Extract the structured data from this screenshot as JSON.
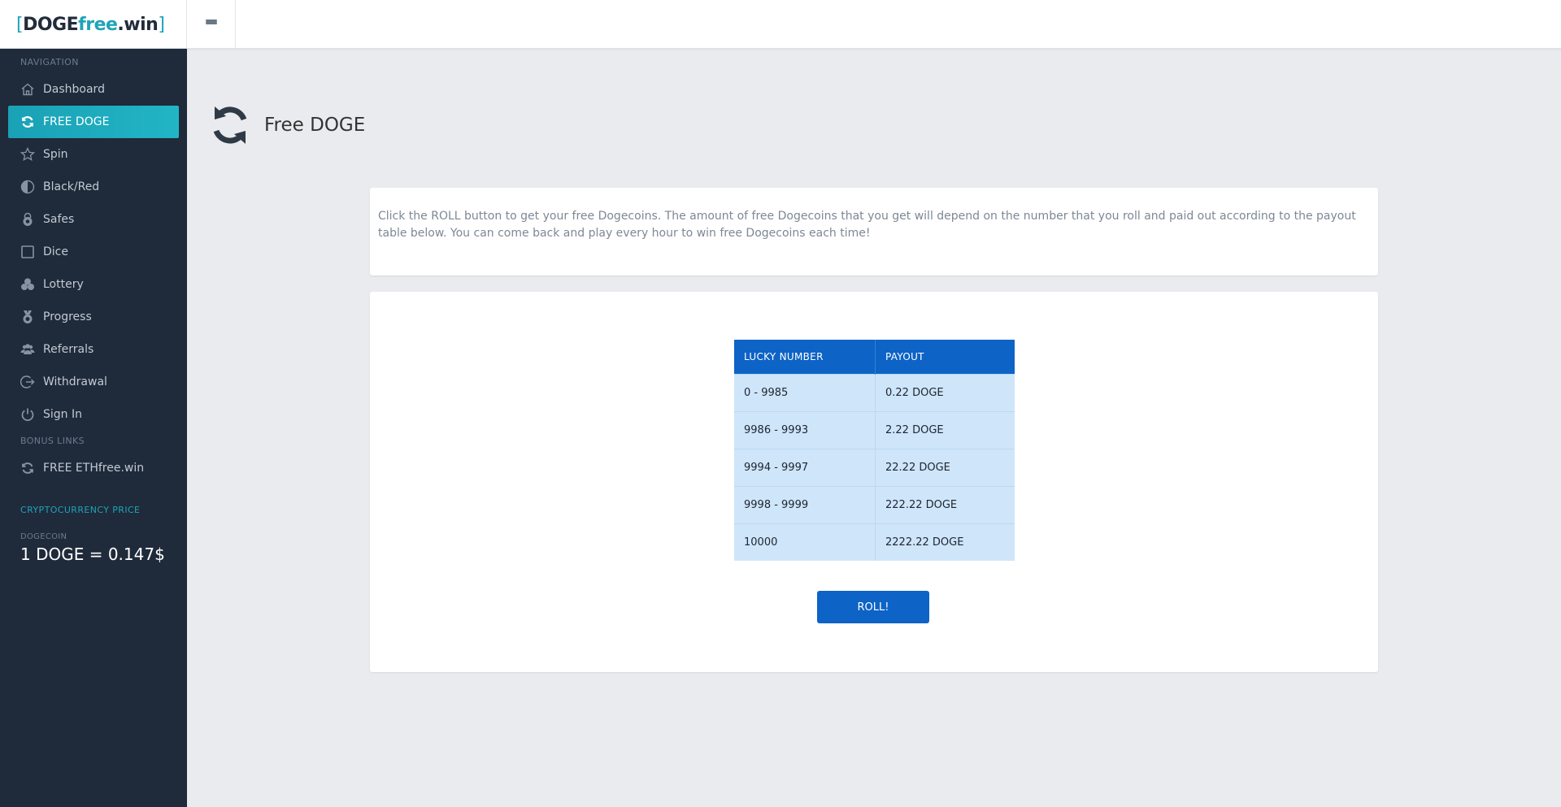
{
  "logo": {
    "open": "[",
    "part1": "DOGE",
    "part2": "free",
    "part3": ".win",
    "close": "]"
  },
  "sidebar": {
    "nav_heading": "NAVIGATION",
    "items": [
      {
        "label": "Dashboard",
        "icon": "home-icon"
      },
      {
        "label": "FREE DOGE",
        "icon": "refresh-icon",
        "active": true
      },
      {
        "label": "Spin",
        "icon": "star-icon"
      },
      {
        "label": "Black/Red",
        "icon": "half-circle-icon"
      },
      {
        "label": "Safes",
        "icon": "lock-icon"
      },
      {
        "label": "Dice",
        "icon": "square-icon"
      },
      {
        "label": "Lottery",
        "icon": "circles-icon"
      },
      {
        "label": "Progress",
        "icon": "medal-icon"
      },
      {
        "label": "Referrals",
        "icon": "users-icon"
      },
      {
        "label": "Withdrawal",
        "icon": "exit-icon"
      },
      {
        "label": "Sign In",
        "icon": "power-icon"
      }
    ],
    "bonus_heading": "BONUS LINKS",
    "bonus_items": [
      {
        "label": "FREE ETHfree.win",
        "icon": "refresh-icon"
      }
    ],
    "price_heading": "CRYPTOCURRENCY PRICE",
    "price_label": "DOGECOIN",
    "price_value": "1 DOGE = 0.147$"
  },
  "page": {
    "title": "Free DOGE",
    "intro": "Click the ROLL button to get your free Dogecoins. The amount of free Dogecoins that you get will depend on the number that you roll and paid out according to the payout table below. You can come back and play every hour to win free Dogecoins each time!"
  },
  "payout_table": {
    "headers": [
      "LUCKY NUMBER",
      "PAYOUT"
    ],
    "rows": [
      [
        "0 - 9985",
        "0.22 DOGE"
      ],
      [
        "9986 - 9993",
        "2.22 DOGE"
      ],
      [
        "9994 - 9997",
        "22.22 DOGE"
      ],
      [
        "9998 - 9999",
        "222.22 DOGE"
      ],
      [
        "10000",
        "2222.22 DOGE"
      ]
    ]
  },
  "roll_button": "ROLL!",
  "colors": {
    "sidebar_bg": "#1f2a3a",
    "accent_teal": "#1fa4b8",
    "table_header": "#0d63c6",
    "table_row": "#cfe5fa",
    "page_bg": "#e9ebee"
  }
}
